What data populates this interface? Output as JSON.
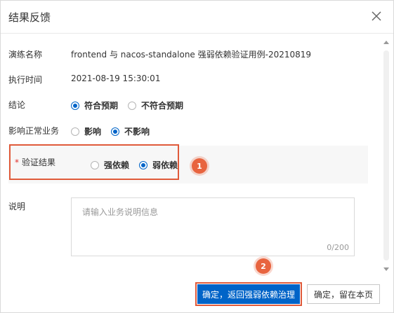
{
  "dialog": {
    "title": "结果反馈",
    "close_icon": "close-icon"
  },
  "form": {
    "drill_name_label": "演练名称",
    "drill_name_value": "frontend 与 nacos-standalone 强弱依赖验证用例-20210819",
    "exec_time_label": "执行时间",
    "exec_time_value": "2021-08-19 15:30:01",
    "conclusion_label": "结论",
    "conclusion_options": [
      "符合预期",
      "不符合预期"
    ],
    "conclusion_selected": "符合预期",
    "impact_label": "影响正常业务",
    "impact_options": [
      "影响",
      "不影响"
    ],
    "impact_selected": "不影响",
    "verify_required_mark": "*",
    "verify_label": "验证结果",
    "verify_options": [
      "强依赖",
      "弱依赖"
    ],
    "verify_selected": "弱依赖",
    "desc_label": "说明",
    "desc_placeholder": "请输入业务说明信息",
    "desc_count": "0/200"
  },
  "annotations": {
    "badge1": "1",
    "badge2": "2",
    "highlight_color": "#e05a3a"
  },
  "footer": {
    "confirm_return_label": "确定，返回强弱依赖治理",
    "confirm_stay_label": "确定，留在本页"
  },
  "colors": {
    "primary": "#0064c8",
    "badge": "#e8643f"
  }
}
